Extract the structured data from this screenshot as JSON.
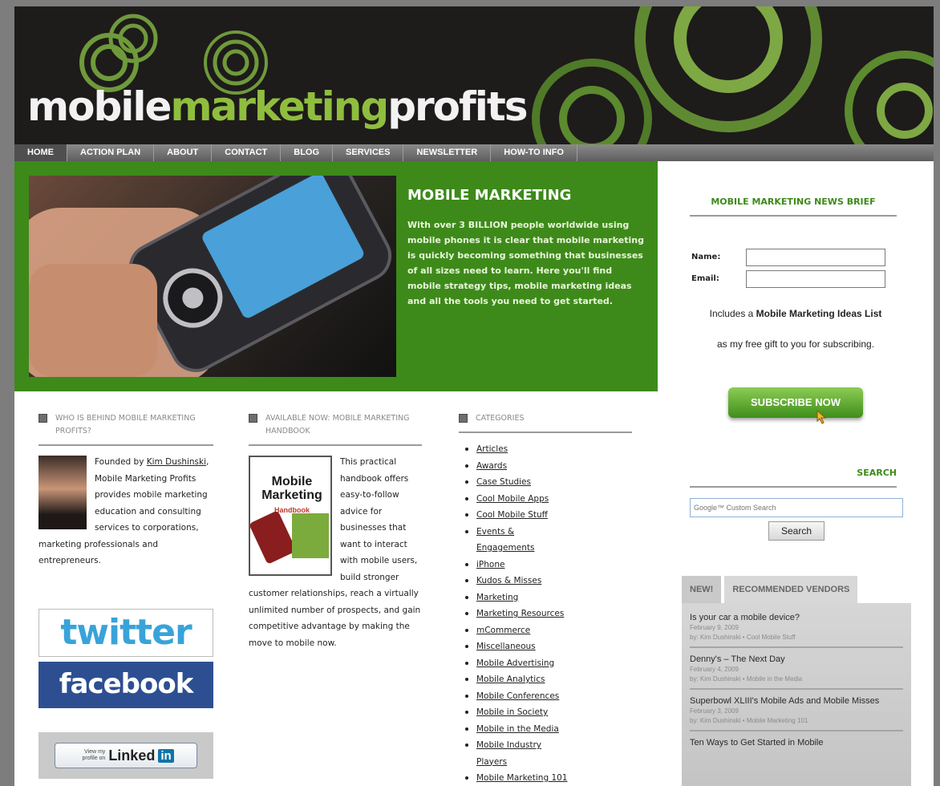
{
  "header": {
    "logo_part1": "mobile",
    "logo_part2": "marketing",
    "logo_part3": "profits"
  },
  "nav": {
    "items": [
      "HOME",
      "ACTION PLAN",
      "ABOUT",
      "CONTACT",
      "BLOG",
      "SERVICES",
      "NEWSLETTER",
      "HOW-TO INFO"
    ],
    "active": "HOME"
  },
  "hero": {
    "title": "MOBILE MARKETING",
    "text": "With over 3 BILLION people worldwide using mobile phones it is clear that mobile marketing is quickly becoming something that businesses of all sizes need to learn. Here you'll find mobile strategy tips, mobile marketing ideas and all the tools you need to get started."
  },
  "about": {
    "heading": "WHO IS BEHIND MOBILE MARKETING PROFITS?",
    "prefix": "Founded by ",
    "link": "Kim Dushinski",
    "suffix": ", Mobile Marketing Profits provides mobile marketing education and consulting services to corporations, marketing professionals and entrepreneurs."
  },
  "handbook": {
    "heading": "AVAILABLE NOW: MOBILE MARKETING HANDBOOK",
    "book_title": "Mobile Marketing",
    "book_subtitle": "Handbook",
    "text": "This practical handbook offers easy-to-follow advice for businesses that want to interact with mobile users, build stronger customer relationships, reach a virtually unlimited number of prospects, and gain competitive advantage by making the move to mobile now."
  },
  "categories": {
    "heading": "CATEGORIES",
    "items": [
      "Articles",
      "Awards",
      "Case Studies",
      "Cool Mobile Apps",
      "Cool Mobile Stuff",
      "Events & Engagements",
      "iPhone",
      "Kudos & Misses",
      "Marketing",
      "Marketing Resources",
      "mCommerce",
      "Miscellaneous",
      "Mobile Advertising",
      "Mobile Analytics",
      "Mobile Conferences",
      "Mobile in Society",
      "Mobile in the Media",
      "Mobile Industry Players",
      "Mobile Marketing 101"
    ]
  },
  "social": {
    "twitter": "twitter",
    "facebook": "facebook",
    "linkedin_small": "View my profile on",
    "linkedin_big": "Linked",
    "linkedin_in": "in"
  },
  "newsletter": {
    "heading": "MOBILE MARKETING NEWS BRIEF",
    "name_label": "Name:",
    "email_label": "Email:",
    "name_value": "",
    "email_value": "",
    "includes_prefix": "Includes a ",
    "includes_bold": "Mobile Marketing Ideas List",
    "gift_text": "as my free gift to you for subscribing.",
    "subscribe": "SUBSCRIBE NOW"
  },
  "search": {
    "heading": "SEARCH",
    "placeholder": "Google™ Custom Search",
    "button": "Search"
  },
  "tabs": {
    "items": [
      "NEW!",
      "RECOMMENDED VENDORS"
    ],
    "posts": [
      {
        "title": "Is your car a mobile device?",
        "date": "February 9, 2009",
        "meta": "by: Kim Dushinski • Cool Mobile Stuff"
      },
      {
        "title": "Denny's – The Next Day",
        "date": "February 4, 2009",
        "meta": "by: Kim Dushinski • Mobile in the Media"
      },
      {
        "title": "Superbowl XLIII's Mobile Ads and Mobile Misses",
        "date": "February 3, 2009",
        "meta": "by: Kim Dushinski • Mobile Marketing 101"
      },
      {
        "title": "Ten Ways to Get Started in Mobile",
        "date": "",
        "meta": ""
      }
    ]
  },
  "colors": {
    "brand_green": "#3d8a1a",
    "logo_green": "#8fbe3e",
    "header_dark": "#1e1b1b"
  }
}
